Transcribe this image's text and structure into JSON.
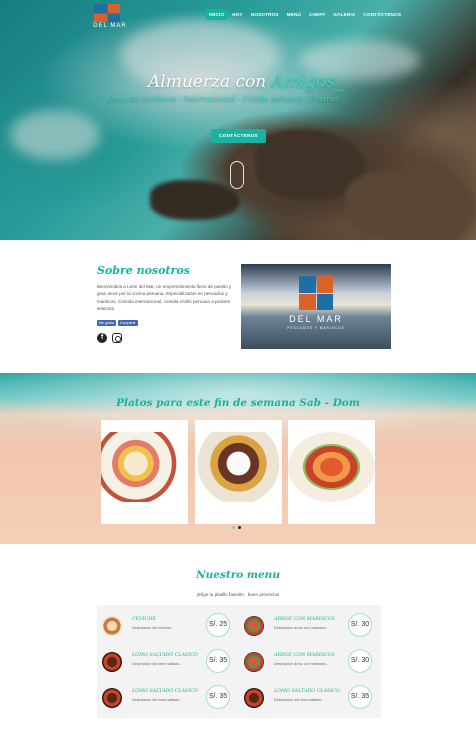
{
  "nav": {
    "logo_name": "DEL MAR",
    "items": [
      {
        "label": "INICIO",
        "active": true
      },
      {
        "label": "HOY"
      },
      {
        "label": "NOSOTROS"
      },
      {
        "label": "MENÚ"
      },
      {
        "label": "CHEFF"
      },
      {
        "label": "GALERIA"
      },
      {
        "label": "CONTÁCTENOS"
      }
    ]
  },
  "hero": {
    "title_main": "Almuerza con ",
    "title_accent": "Amigos_",
    "subtitle": "Pescado mariscos - Internacional - Criollo peruano - Postres",
    "cta_label": "CONTÁCTENOS"
  },
  "about": {
    "title": "Sobre nosotros",
    "text": "Bienvenidos a León del Mar, un emprendimiento lleno de pasión y gran amor por la cocina peruana. Especializados en pescados y mariscos, Comida internacional, comida criollo peruana a postres selectos.",
    "fb_like": "Me gusta",
    "fb_share": "Compartir",
    "image_name": "DEL MAR",
    "image_tag": "PESCADOS Y MARISCOS"
  },
  "weekend": {
    "title": "Platos para este fin de semana Sab - Dom",
    "cards": [
      "ceviche",
      "lomo saltado",
      "arroz con mariscos"
    ],
    "slides": 2,
    "active_slide": 1
  },
  "menu": {
    "title": "Nuestro menu",
    "subtitle": "¡Elige tu platillo favorito , buen provecho!",
    "items": [
      {
        "name": "CEVICHE",
        "desc": "Descripcion del ceviche...",
        "price": "S/. 25",
        "thumb": "ceviche"
      },
      {
        "name": "ARROZ CON MARISCOS",
        "desc": "Descripcion arroz con mariscos...",
        "price": "S/. 30",
        "thumb": "arroz"
      },
      {
        "name": "LOMO SALTADO CLASICO",
        "desc": "Descripcion del lomo saltado...",
        "price": "S/. 35",
        "thumb": "lomo"
      },
      {
        "name": "ARROZ CON MARISCOS",
        "desc": "Descripcion arroz con mariscos...",
        "price": "S/. 30",
        "thumb": "arroz"
      },
      {
        "name": "LOMO SALTADO CLASICO",
        "desc": "Descripcion del lomo saltado...",
        "price": "S/. 35",
        "thumb": "lomo"
      },
      {
        "name": "LOMO SALTADO CLASICO",
        "desc": "Descripcion del lomo saltado...",
        "price": "S/. 35",
        "thumb": "lomo"
      }
    ]
  },
  "colors": {
    "accent": "#19b29e",
    "accent_light": "#3fd3ba"
  }
}
